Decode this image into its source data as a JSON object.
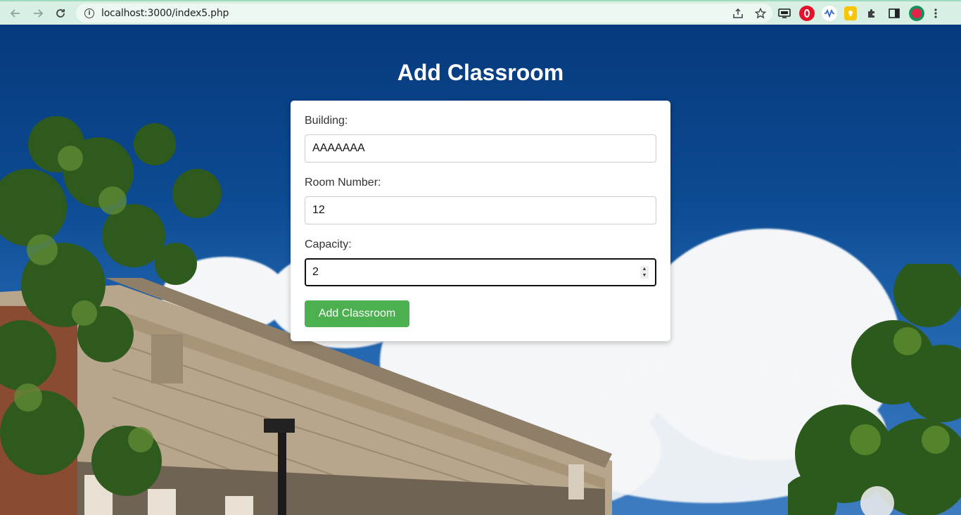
{
  "browser": {
    "url": "localhost:3000/index5.php",
    "back_icon": "arrow-left-icon",
    "forward_icon": "arrow-right-icon",
    "reload_icon": "reload-icon",
    "info_icon": "info-icon",
    "share_icon": "share-icon",
    "bookmark_icon": "star-icon",
    "extensions": [
      "cast-icon",
      "opera-icon",
      "audio-wave-icon",
      "keep-icon",
      "puzzle-icon",
      "side-panel-icon",
      "profile-avatar"
    ],
    "menu_icon": "kebab-menu-icon"
  },
  "page": {
    "title": "Add Classroom"
  },
  "form": {
    "building": {
      "label": "Building:",
      "value": "AAAAAAA"
    },
    "room_number": {
      "label": "Room Number:",
      "value": "12"
    },
    "capacity": {
      "label": "Capacity:",
      "value": "2"
    },
    "submit_label": "Add Classroom"
  },
  "colors": {
    "submit": "#4caf50",
    "chrome": "#d8f0e4",
    "sky": "#0c4a92"
  }
}
